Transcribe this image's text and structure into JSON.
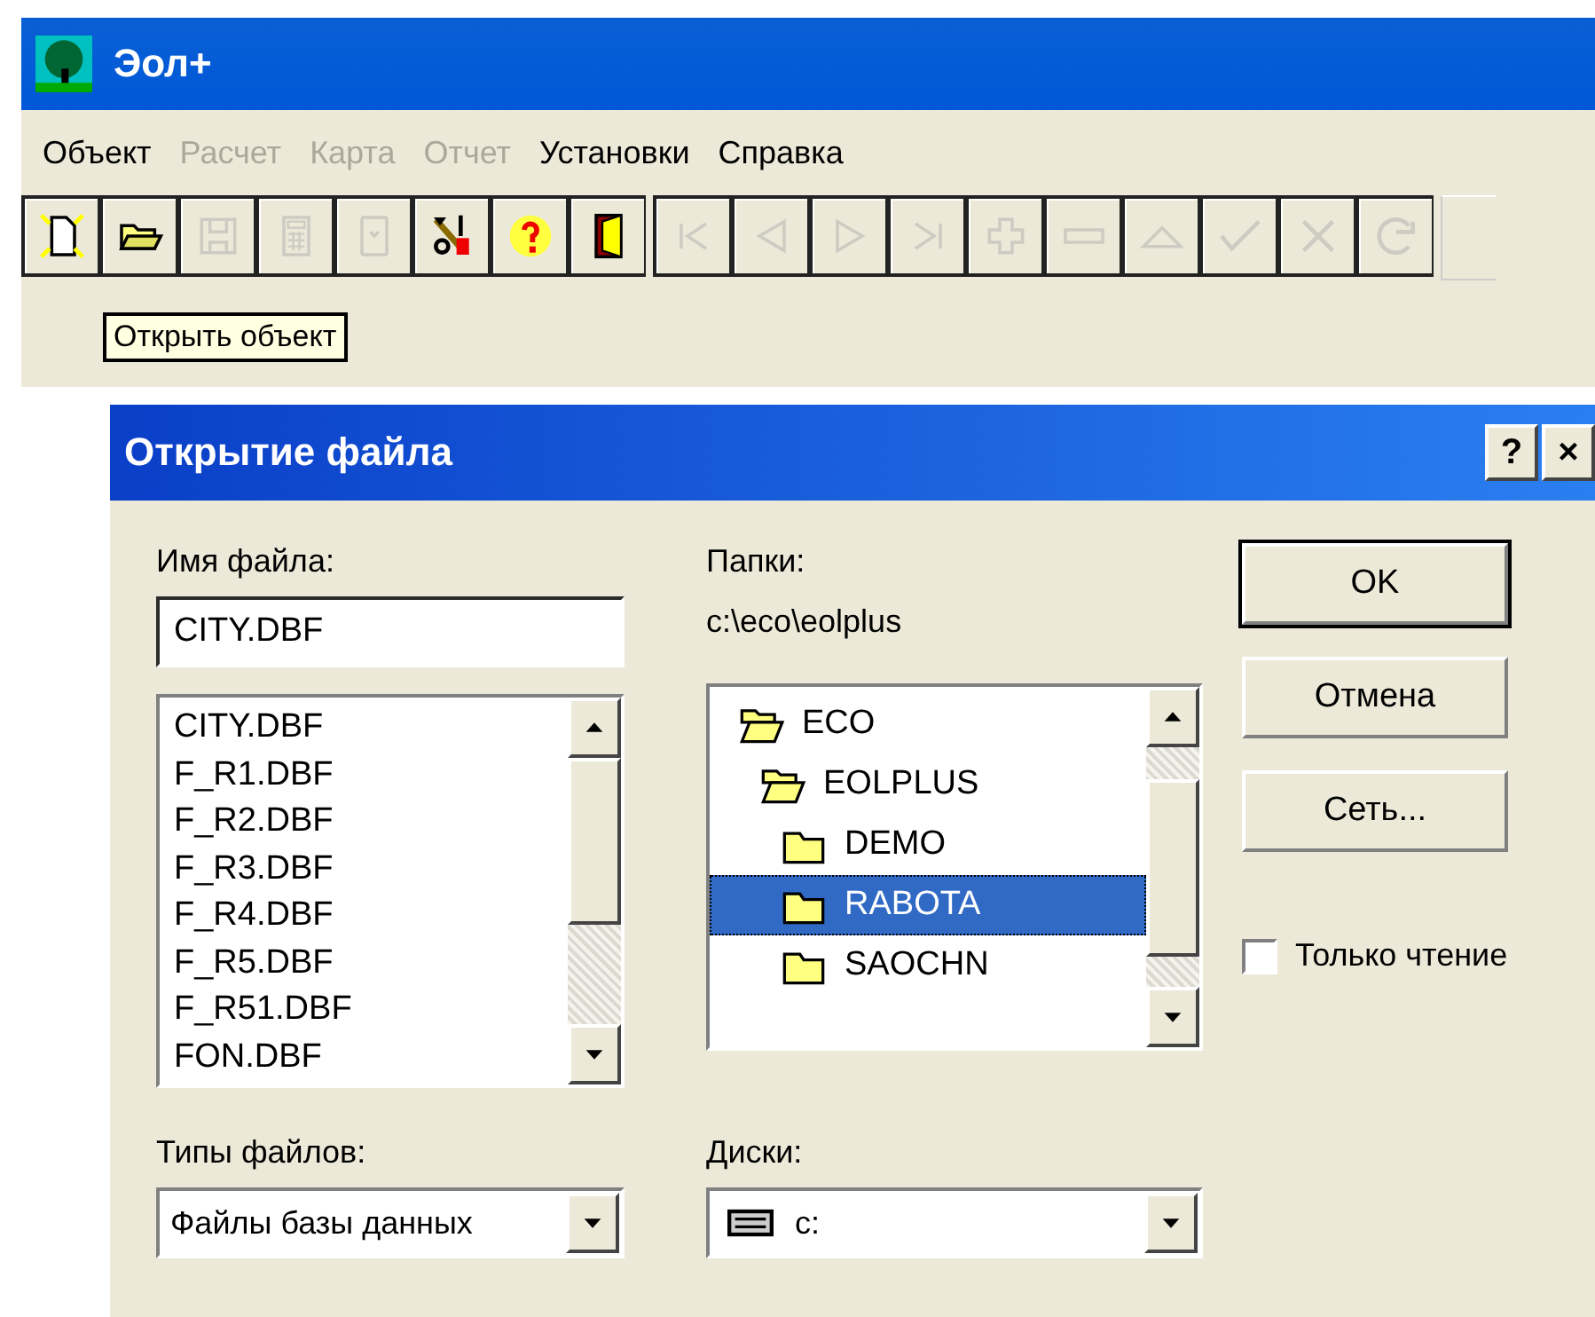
{
  "window": {
    "title": "Эол+"
  },
  "menu": [
    {
      "label": "Объект",
      "disabled": false
    },
    {
      "label": "Расчет",
      "disabled": true
    },
    {
      "label": "Карта",
      "disabled": true
    },
    {
      "label": "Отчет",
      "disabled": true
    },
    {
      "label": "Установки",
      "disabled": false
    },
    {
      "label": "Справка",
      "disabled": false
    }
  ],
  "toolbar": [
    {
      "kind": "new",
      "disabled": false
    },
    {
      "kind": "open",
      "disabled": false
    },
    {
      "kind": "save",
      "disabled": true
    },
    {
      "kind": "calc",
      "disabled": true
    },
    {
      "kind": "card",
      "disabled": true
    },
    {
      "kind": "tools",
      "disabled": false
    },
    {
      "kind": "help",
      "disabled": false
    },
    {
      "kind": "exit",
      "disabled": false
    },
    {
      "kind": "first",
      "disabled": true
    },
    {
      "kind": "prev",
      "disabled": true
    },
    {
      "kind": "next",
      "disabled": true
    },
    {
      "kind": "last",
      "disabled": true
    },
    {
      "kind": "add",
      "disabled": true
    },
    {
      "kind": "remove",
      "disabled": true
    },
    {
      "kind": "up",
      "disabled": true
    },
    {
      "kind": "apply",
      "disabled": true
    },
    {
      "kind": "cancel",
      "disabled": true
    },
    {
      "kind": "refresh",
      "disabled": true
    }
  ],
  "tooltip": "Открыть объект",
  "dialog": {
    "title": "Открытие файла",
    "help_button": "?",
    "close_button": "×",
    "file_name": {
      "label": "Имя файла:",
      "value": "CITY.DBF",
      "files": [
        "CITY.DBF",
        "F_R1.DBF",
        "F_R2.DBF",
        "F_R3.DBF",
        "F_R4.DBF",
        "F_R5.DBF",
        "F_R51.DBF",
        "FON.DBF"
      ]
    },
    "folders": {
      "label": "Папки:",
      "path": "c:\\eco\\eolplus",
      "tree": [
        {
          "name": "ECO",
          "expanded": true,
          "selected": false,
          "children": [
            {
              "name": "EOLPLUS",
              "expanded": true,
              "selected": false,
              "children": [
                {
                  "name": "DEMO",
                  "expanded": false,
                  "selected": false
                },
                {
                  "name": "RABOTA",
                  "expanded": false,
                  "selected": true
                },
                {
                  "name": "SAOCHN",
                  "expanded": false,
                  "selected": false
                }
              ]
            }
          ]
        }
      ]
    },
    "buttons": [
      {
        "label": "OK",
        "default": true
      },
      {
        "label": "Отмена",
        "default": false
      },
      {
        "label": "Сеть...",
        "default": false
      }
    ],
    "read_only": {
      "label": "Только чтение",
      "checked": false
    },
    "file_types": {
      "label": "Типы файлов:",
      "value": "Файлы базы данных"
    },
    "drives": {
      "label": "Диски:",
      "value": "c:"
    }
  }
}
